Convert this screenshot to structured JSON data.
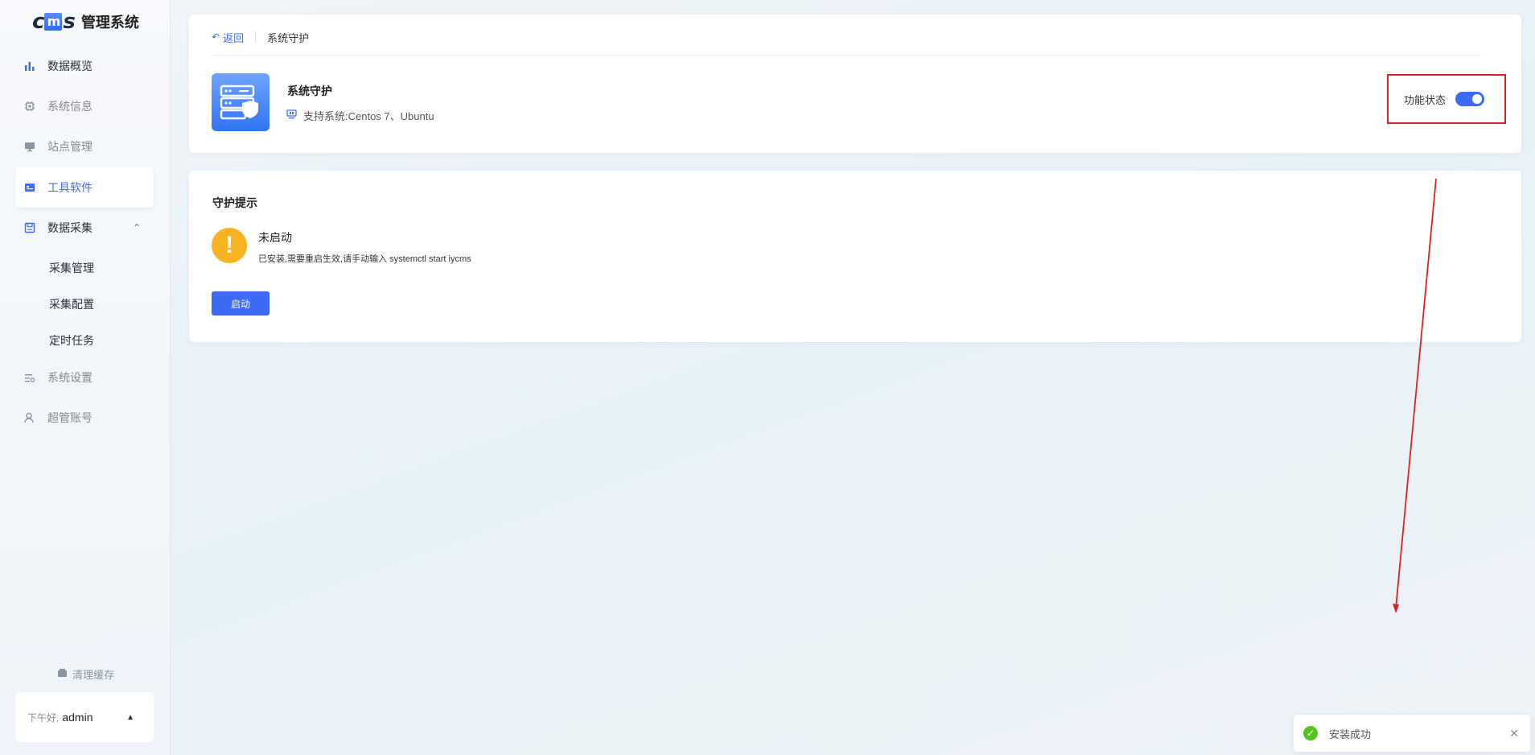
{
  "sidebar": {
    "logo_mark": "cms",
    "logo_title": "管理系统",
    "items": [
      {
        "label": "数据概览",
        "icon": "bar-chart-icon"
      },
      {
        "label": "系统信息",
        "icon": "chip-icon"
      },
      {
        "label": "站点管理",
        "icon": "monitor-icon"
      },
      {
        "label": "工具软件",
        "icon": "toolbox-icon"
      },
      {
        "label": "数据采集",
        "icon": "save-icon"
      },
      {
        "label": "系统设置",
        "icon": "settings-sliders-icon"
      },
      {
        "label": "超管账号",
        "icon": "user-icon"
      }
    ],
    "sub_items": [
      "采集管理",
      "采集配置",
      "定时任务"
    ],
    "clear_cache": "清理缓存",
    "greeting": "下午好,",
    "username": "admin"
  },
  "header": {
    "back_label": "返回",
    "current_crumb": "系统守护"
  },
  "plugin": {
    "name": "系统守护",
    "systems": "支持系统:Centos 7、Ubuntu",
    "status_label": "功能状态",
    "enabled": true
  },
  "guard": {
    "title": "守护提示",
    "state": "未启动",
    "description": "已安装,需要重启生效,请手动输入 systemctl start iycms",
    "start_button": "启动"
  },
  "toast": {
    "message": "安装成功"
  },
  "colors": {
    "accent": "#3c6cf6",
    "warning": "#f7b322",
    "success": "#52c41a",
    "annotation": "#e02020"
  }
}
